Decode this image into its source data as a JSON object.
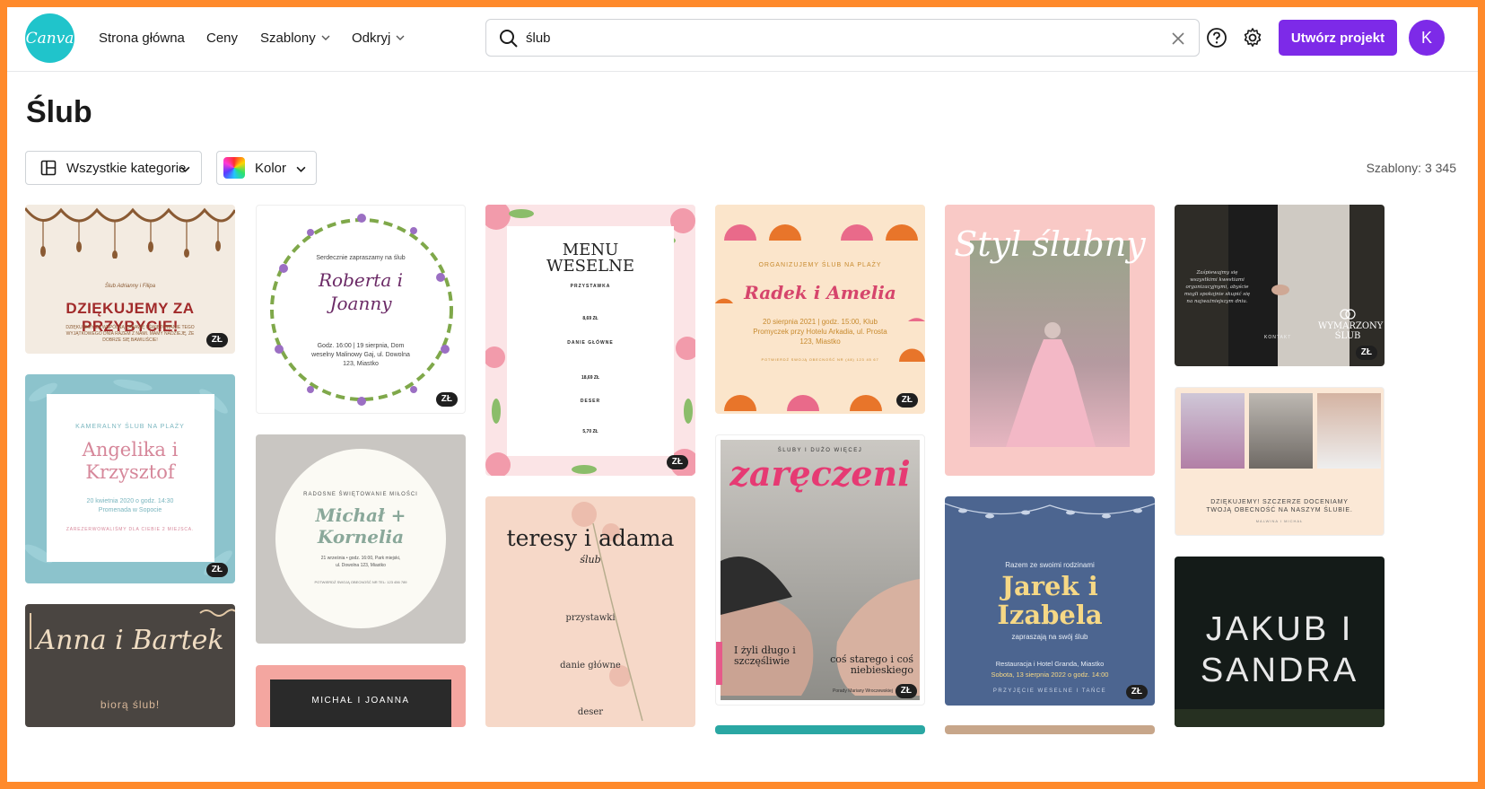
{
  "app": {
    "logo_text": "Canva"
  },
  "nav": {
    "home": "Strona główna",
    "pricing": "Ceny",
    "templates": "Szablony",
    "discover": "Odkryj"
  },
  "search": {
    "value": "ślub",
    "placeholder": ""
  },
  "header": {
    "create_label": "Utwórz projekt",
    "avatar_initial": "K"
  },
  "page": {
    "title": "Ślub",
    "filters": {
      "category": "Wszystkie kategorie",
      "color": "Kolor"
    },
    "count": "Szablony: 3 345"
  },
  "badge_label": "ZŁ",
  "cards": {
    "c1": {
      "small": "Ślub Adrianny i Filipa",
      "main": "DZIĘKUJEMY ZA PRZYBYCIE!",
      "text": "DZIĘKUJEMY ZA WSPÓLNĄ ZABAWĘ I ŚWIĘTOWANIE TEGO WYJĄTKOWEGO DNIA RAZEM Z NAMI. MAMY NADZIEJĘ, ŻE DOBRZE SIĘ BAWILIŚCIE!"
    },
    "c2": {
      "top": "KAMERALNY ŚLUB NA PLAŻY",
      "main": "Angelika i Krzysztof",
      "date": "20 kwietnia 2020 o godz. 14:30",
      "place": "Promenada w Sopocie",
      "footer": "ZAREZERWOWALIŚMY DLA CIEBIE 2 MIEJSCA."
    },
    "c3": {
      "main": "Anna i Bartek",
      "sub": "biorą ślub!"
    },
    "c4": {
      "top": "Serdecznie zapraszamy na ślub",
      "main": "Roberta i Joanny",
      "info": "Godz. 16:00 | 19 sierpnia, Dom weselny Malinowy Gaj, ul. Dowolna 123, Miastko"
    },
    "c5": {
      "top": "RADOSNE ŚWIĘTOWANIE MIŁOŚCI",
      "main": "Michał + Kornelia",
      "info": "21 września • godz. 16:00, Park miejski, ul. Dowolna 123, Miastko",
      "footer": "POTWIERDŹ SWOJĄ OBECNOŚĆ NR TEL: 123 456 789"
    },
    "c6": {
      "main": "MICHAŁ I JOANNA"
    },
    "c7": {
      "title": "MENU WESELNE",
      "s1": "PRZYSTAWKA",
      "p1": "8,69 ZŁ",
      "s2": "DANIE GŁÓWNE",
      "p2": "18,69 ZŁ",
      "s3": "DESER",
      "p3": "5,70 ZŁ"
    },
    "c8": {
      "main": "teresy i adama",
      "sub": "ślub",
      "s1": "przystawki",
      "s2": "danie główne",
      "s3": "deser"
    },
    "c9": {
      "top": "ORGANIZUJEMY ŚLUB NA PLAŻY",
      "main": "Radek i Amelia",
      "info": "20 sierpnia 2021 | godz. 15:00, Klub Promyczek przy Hotelu Arkadia, ul. Prosta 123, Miastko",
      "footer": "POTWIERDŹ SWOJĄ OBECNOŚĆ NR (48) 123 45 67"
    },
    "c10": {
      "top": "ŚLUBY I DUŻO WIĘCEJ",
      "main": "zaręczeni",
      "left": "I żyli długo i szczęśliwie",
      "right": "coś starego i coś niebieskiego",
      "footer": "Porady Mariany Wroczewskiej"
    },
    "c11": {
      "main": "Styl ślubny"
    },
    "c12": {
      "top": "Razem ze swoimi rodzinami",
      "main": "Jarek i Izabela",
      "sub": "zapraszają na swój ślub",
      "place": "Restauracja i Hotel Granda, Miastko",
      "date": "Sobota, 13 sierpnia 2022 o godz. 14:00",
      "footer": "PRZYJĘCIE WESELNE I TAŃCE"
    },
    "c13": {
      "text": "Zaśpiewajmy się wszystkimi kwestiami organizacyjnymi, abyście mogli spokojnie skupić się na najważniejszym dniu.",
      "contact": "KONTAKT",
      "main": "WYMARZONY ŚLUB"
    },
    "c14": {
      "main": "DZIĘKUJEMY! SZCZERZE DOCENIAMY TWOJĄ OBECNOŚĆ NA NASZYM ŚLUBIE.",
      "sub": "MALWINA I MICHAŁ"
    },
    "c15": {
      "main": "JAKUB I SANDRA"
    }
  }
}
